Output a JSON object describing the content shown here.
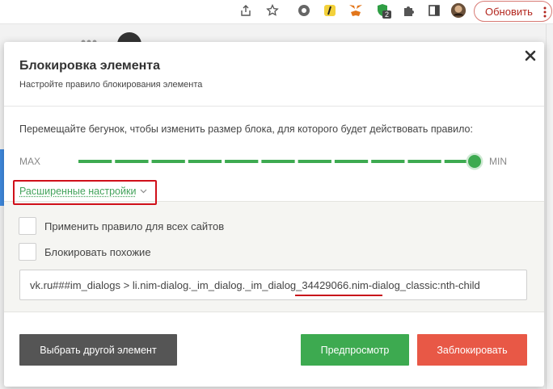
{
  "browser": {
    "update_label": "Обновить",
    "extension_badge": "2"
  },
  "modal": {
    "title": "Блокировка элемента",
    "subtitle": "Настройте правило блокирования элемента",
    "instruction": "Перемещайте бегунок, чтобы изменить размер блока, для которого будет действовать правило:",
    "slider": {
      "max_label": "MAX",
      "min_label": "MIN",
      "segments": 11,
      "position_fraction": 1.0,
      "accent_color": "#3daa50"
    },
    "advanced_label": "Расширенные настройки",
    "options": [
      {
        "label": "Применить правило для всех сайтов",
        "checked": false
      },
      {
        "label": "Блокировать похожие",
        "checked": false
      }
    ],
    "selector_value": "vk.ru###im_dialogs > li.nim-dialog._im_dialog._im_dialog_34429066.nim-dialog_classic:nth-child",
    "buttons": {
      "other": "Выбрать другой элемент",
      "preview": "Предпросмотр",
      "block": "Заблокировать"
    },
    "colors": {
      "preview": "#3daa50",
      "block": "#e85846",
      "other": "#555555",
      "highlight": "#d0101a"
    }
  }
}
